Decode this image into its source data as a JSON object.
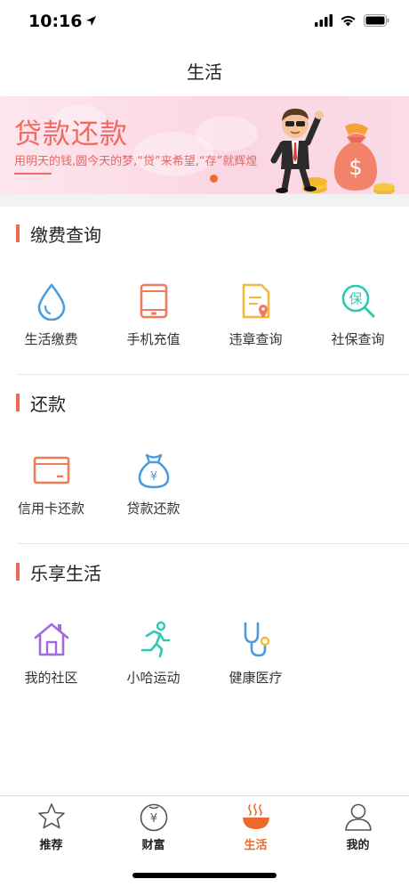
{
  "status": {
    "time": "10:16"
  },
  "nav": {
    "title": "生活"
  },
  "banner": {
    "title": "贷款还款",
    "subtitle": "用明天的钱,圆今天的梦,“贷”来希望,“存”就辉煌"
  },
  "sections": [
    {
      "title": "缴费查询",
      "items": [
        {
          "label": "生活缴费",
          "icon": "water-drop-icon"
        },
        {
          "label": "手机充值",
          "icon": "tablet-icon"
        },
        {
          "label": "违章查询",
          "icon": "document-pin-icon"
        },
        {
          "label": "社保查询",
          "icon": "social-security-search-icon",
          "glyph": "保"
        }
      ]
    },
    {
      "title": "还款",
      "items": [
        {
          "label": "信用卡还款",
          "icon": "credit-card-icon"
        },
        {
          "label": "贷款还款",
          "icon": "money-bag-icon",
          "glyph": "¥"
        }
      ]
    },
    {
      "title": "乐享生活",
      "items": [
        {
          "label": "我的社区",
          "icon": "house-icon"
        },
        {
          "label": "小哈运动",
          "icon": "running-person-icon"
        },
        {
          "label": "健康医疗",
          "icon": "stethoscope-icon"
        }
      ]
    }
  ],
  "tabbar": {
    "active": 2,
    "items": [
      {
        "label": "推荐",
        "icon": "star-icon"
      },
      {
        "label": "财富",
        "icon": "wealth-bag-icon",
        "glyph": "¥"
      },
      {
        "label": "生活",
        "icon": "hot-bowl-icon"
      },
      {
        "label": "我的",
        "icon": "person-icon"
      }
    ]
  },
  "colors": {
    "accent": "#ee6a52",
    "tab_active": "#ee6a2a",
    "blue": "#4a9be0",
    "orange": "#f07a5c",
    "yellow": "#f5b83a",
    "teal": "#2ec9b0",
    "purple": "#a16be0"
  }
}
